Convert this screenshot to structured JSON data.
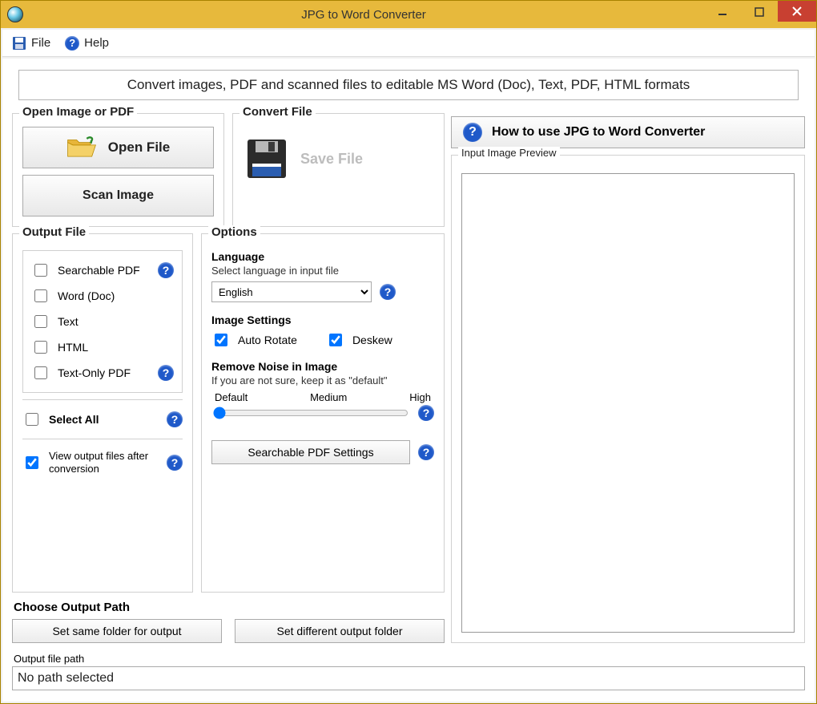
{
  "titlebar": {
    "title": "JPG to Word Converter"
  },
  "menu": {
    "file": "File",
    "help": "Help"
  },
  "banner": "Convert images, PDF and scanned files to editable MS Word (Doc), Text, PDF, HTML formats",
  "open_group": {
    "title": "Open Image or PDF",
    "open_file": "Open File",
    "scan_image": "Scan Image"
  },
  "convert_group": {
    "title": "Convert File",
    "save_file": "Save File"
  },
  "output_group": {
    "title": "Output File",
    "items": [
      {
        "label": "Searchable PDF",
        "help": true
      },
      {
        "label": "Word (Doc)",
        "help": false
      },
      {
        "label": "Text",
        "help": false
      },
      {
        "label": "HTML",
        "help": false
      },
      {
        "label": "Text-Only PDF",
        "help": true
      }
    ],
    "select_all": "Select All",
    "view_after": "View output files after conversion"
  },
  "options_group": {
    "title": "Options",
    "language_title": "Language",
    "language_note": "Select language in input file",
    "language_value": "English",
    "image_settings_title": "Image Settings",
    "auto_rotate": "Auto Rotate",
    "deskew": "Deskew",
    "noise_title": "Remove Noise in Image",
    "noise_note": "If you are not sure, keep it as \"default\"",
    "noise_labels": {
      "low": "Default",
      "mid": "Medium",
      "high": "High"
    },
    "pdf_settings_btn": "Searchable PDF Settings"
  },
  "howto": "How to use JPG to Word Converter",
  "preview_title": "Input Image Preview",
  "choose_path": {
    "title": "Choose Output Path",
    "same": "Set same folder for output",
    "diff": "Set different output folder"
  },
  "output_path": {
    "label": "Output file path",
    "value": "No path selected"
  }
}
